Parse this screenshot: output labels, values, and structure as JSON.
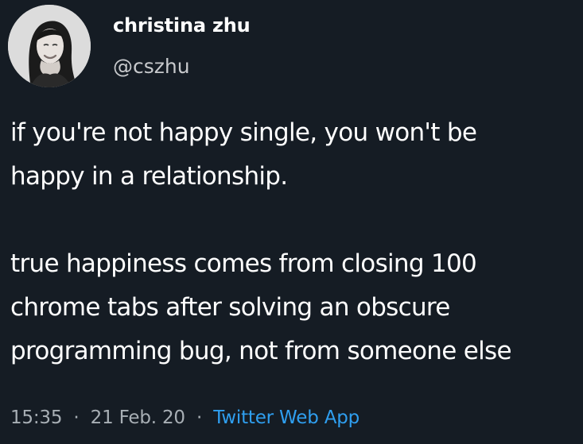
{
  "author": {
    "display_name": "christina zhu",
    "handle": "@cszhu",
    "avatar_icon": "person-avatar-icon"
  },
  "tweet": {
    "paragraphs": [
      "if you're not happy single, you won't be\nhappy in a relationship.",
      "true happiness comes from closing 100\nchrome tabs after solving an obscure\nprogramming bug, not from someone else"
    ]
  },
  "meta": {
    "time": "15:35",
    "date": "21 Feb. 20",
    "separator": "·",
    "source": "Twitter Web App"
  },
  "colors": {
    "background": "#151c24",
    "text": "#ffffff",
    "secondary_text": "#a8afb5",
    "link": "#2f9ff0"
  }
}
